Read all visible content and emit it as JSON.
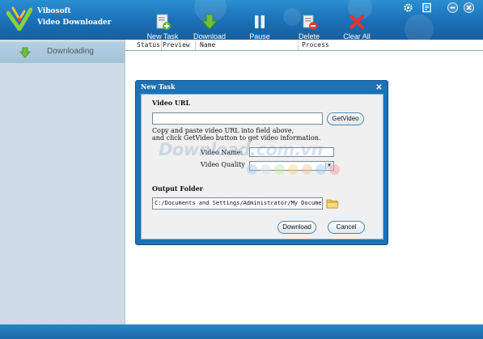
{
  "app": {
    "brand_line1": "Vibosoft",
    "brand_line2": "Video Downloader"
  },
  "toolbar": {
    "items": [
      {
        "label": "New Task",
        "icon": "new-task-icon"
      },
      {
        "label": "Download",
        "icon": "download-arrow-icon"
      },
      {
        "label": "Pause",
        "icon": "pause-icon"
      },
      {
        "label": "Delete",
        "icon": "delete-icon"
      },
      {
        "label": "Clear All",
        "icon": "clear-x-icon"
      }
    ]
  },
  "window_controls": [
    "gear-icon",
    "skin-icon",
    "minimize-icon",
    "close-icon"
  ],
  "sidebar": {
    "items": [
      {
        "label": "Downloading",
        "icon": "download-arrow-icon",
        "selected": true
      }
    ]
  },
  "list": {
    "columns": [
      "Status",
      "Preview",
      "Name",
      "Process"
    ]
  },
  "dialog": {
    "title": "New Task",
    "video_url_label": "Video URL",
    "url_value": "",
    "getvideo_label": "GetVideo",
    "hint_line1": "Copy and paste video URL into field above,",
    "hint_line2": "and click GetVideo button to get video information.",
    "video_name_label": "Video Name:",
    "video_name_value": "",
    "video_quality_label": "Video Quality",
    "video_quality_value": "",
    "output_folder_label": "Output Folder",
    "output_folder_value": "C:/Documents and Settings/Administrator/My Documents",
    "download_label": "Download",
    "cancel_label": "Cancel"
  },
  "watermark": {
    "text": "Download.com.vn",
    "dot_colors": [
      "#9fc7e6",
      "#d7dde2",
      "#bde6a1",
      "#f5d78c",
      "#f0c59b",
      "#9ac9ef",
      "#f09a9a"
    ]
  },
  "colors": {
    "header": "#1b6fb6",
    "sidebar": "#ccdbe6",
    "dialog_frame": "#1c72b5"
  }
}
